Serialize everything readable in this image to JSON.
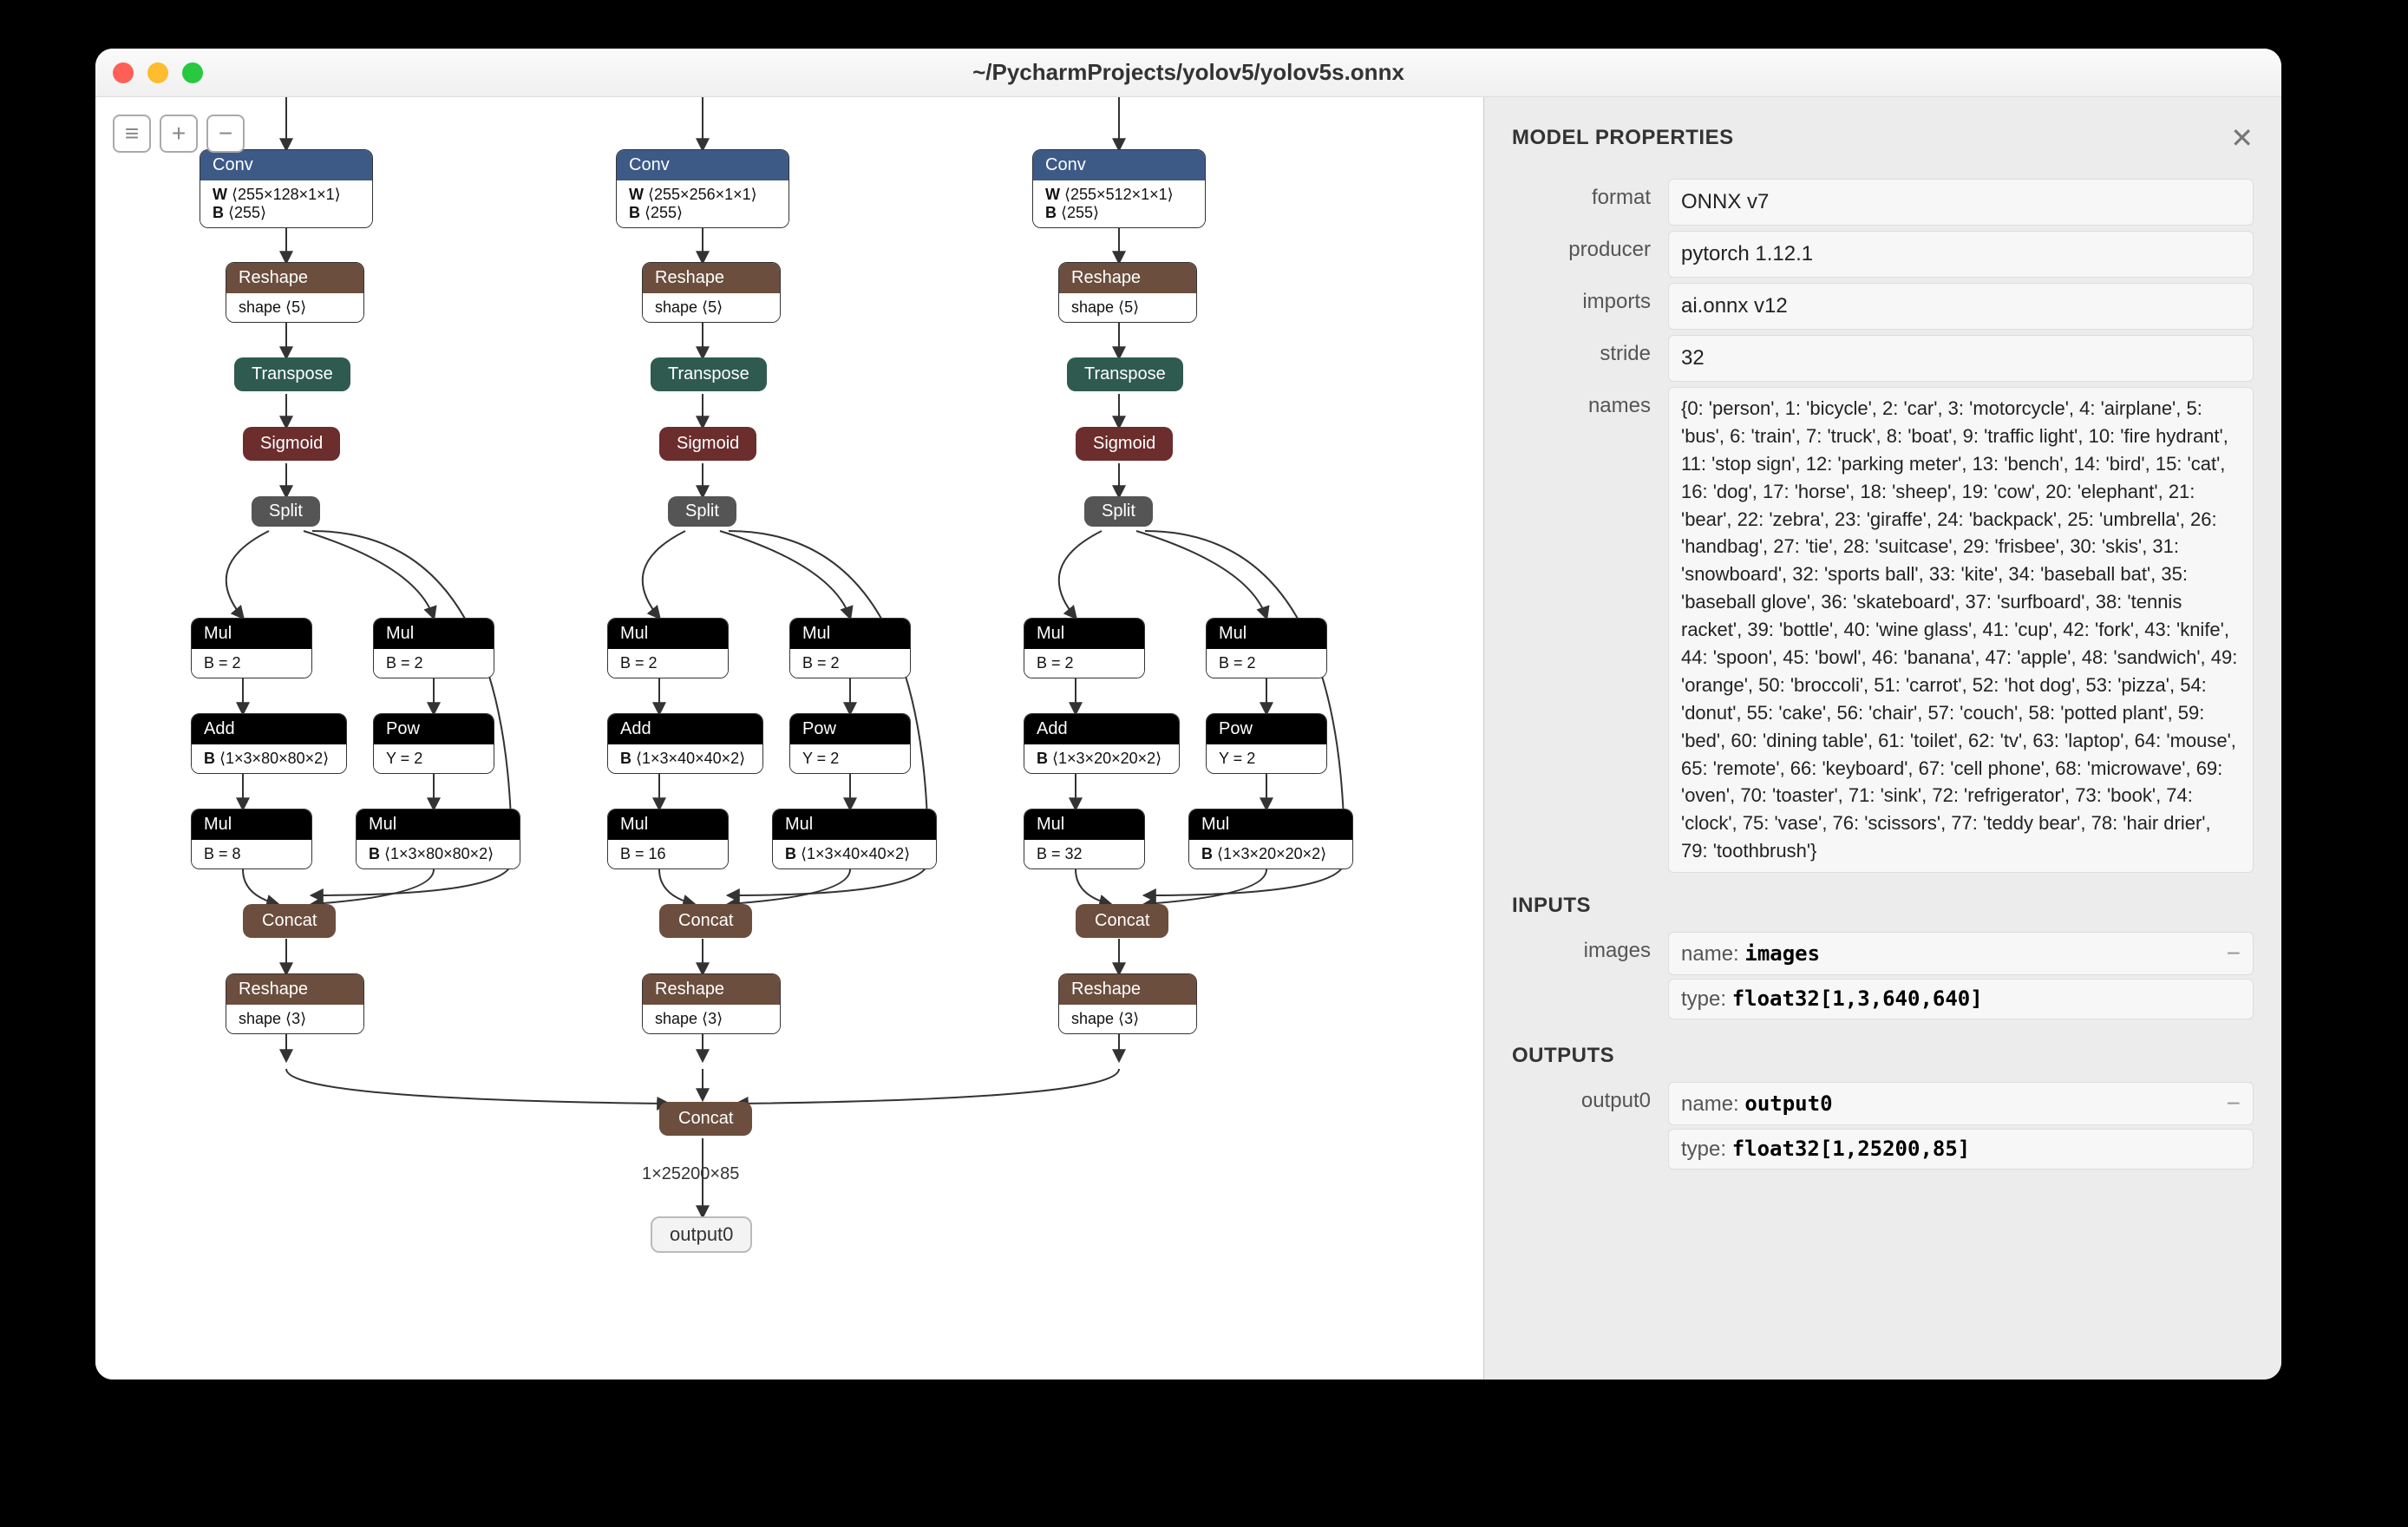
{
  "window_title": "~/PycharmProjects/yolov5/yolov5s.onnx",
  "sidebar": {
    "title": "MODEL PROPERTIES",
    "props": {
      "format": {
        "label": "format",
        "value": "ONNX v7"
      },
      "producer": {
        "label": "producer",
        "value": "pytorch 1.12.1"
      },
      "imports": {
        "label": "imports",
        "value": "ai.onnx v12"
      },
      "stride": {
        "label": "stride",
        "value": "32"
      },
      "names": {
        "label": "names",
        "value": "{0: 'person', 1: 'bicycle', 2: 'car', 3: 'motorcycle', 4: 'airplane', 5: 'bus', 6: 'train', 7: 'truck', 8: 'boat', 9: 'traffic light', 10: 'fire hydrant', 11: 'stop sign', 12: 'parking meter', 13: 'bench', 14: 'bird', 15: 'cat', 16: 'dog', 17: 'horse', 18: 'sheep', 19: 'cow', 20: 'elephant', 21: 'bear', 22: 'zebra', 23: 'giraffe', 24: 'backpack', 25: 'umbrella', 26: 'handbag', 27: 'tie', 28: 'suitcase', 29: 'frisbee', 30: 'skis', 31: 'snowboard', 32: 'sports ball', 33: 'kite', 34: 'baseball bat', 35: 'baseball glove', 36: 'skateboard', 37: 'surfboard', 38: 'tennis racket', 39: 'bottle', 40: 'wine glass', 41: 'cup', 42: 'fork', 43: 'knife', 44: 'spoon', 45: 'bowl', 46: 'banana', 47: 'apple', 48: 'sandwich', 49: 'orange', 50: 'broccoli', 51: 'carrot', 52: 'hot dog', 53: 'pizza', 54: 'donut', 55: 'cake', 56: 'chair', 57: 'couch', 58: 'potted plant', 59: 'bed', 60: 'dining table', 61: 'toilet', 62: 'tv', 63: 'laptop', 64: 'mouse', 65: 'remote', 66: 'keyboard', 67: 'cell phone', 68: 'microwave', 69: 'oven', 70: 'toaster', 71: 'sink', 72: 'refrigerator', 73: 'book', 74: 'clock', 75: 'vase', 76: 'scissors', 77: 'teddy bear', 78: 'hair drier', 79: 'toothbrush'}"
      }
    },
    "inputs_title": "INPUTS",
    "inputs": [
      {
        "slot": "images",
        "name_label": "name:",
        "name": "images",
        "type_label": "type:",
        "type": "float32[1,3,640,640]"
      }
    ],
    "outputs_title": "OUTPUTS",
    "outputs": [
      {
        "slot": "output0",
        "name_label": "name:",
        "name": "output0",
        "type_label": "type:",
        "type": "float32[1,25200,85]"
      }
    ]
  },
  "graph": {
    "columns": [
      {
        "conv": {
          "op": "Conv",
          "w": "W  ⟨255×128×1×1⟩",
          "b": "B  ⟨255⟩"
        },
        "reshape1": {
          "op": "Reshape",
          "body": "shape  ⟨5⟩"
        },
        "transpose": "Transpose",
        "sigmoid": "Sigmoid",
        "split": "Split",
        "mul1": {
          "op": "Mul",
          "body": "B = 2"
        },
        "mul2": {
          "op": "Mul",
          "body": "B = 2"
        },
        "add": {
          "op": "Add",
          "body": "B  ⟨1×3×80×80×2⟩"
        },
        "pow": {
          "op": "Pow",
          "body": "Y = 2"
        },
        "mul3": {
          "op": "Mul",
          "body": "B = 8"
        },
        "mul4": {
          "op": "Mul",
          "body": "B  ⟨1×3×80×80×2⟩"
        },
        "concat1": "Concat",
        "reshape2": {
          "op": "Reshape",
          "body": "shape  ⟨3⟩"
        }
      },
      {
        "conv": {
          "op": "Conv",
          "w": "W  ⟨255×256×1×1⟩",
          "b": "B  ⟨255⟩"
        },
        "reshape1": {
          "op": "Reshape",
          "body": "shape  ⟨5⟩"
        },
        "transpose": "Transpose",
        "sigmoid": "Sigmoid",
        "split": "Split",
        "mul1": {
          "op": "Mul",
          "body": "B = 2"
        },
        "mul2": {
          "op": "Mul",
          "body": "B = 2"
        },
        "add": {
          "op": "Add",
          "body": "B  ⟨1×3×40×40×2⟩"
        },
        "pow": {
          "op": "Pow",
          "body": "Y = 2"
        },
        "mul3": {
          "op": "Mul",
          "body": "B = 16"
        },
        "mul4": {
          "op": "Mul",
          "body": "B  ⟨1×3×40×40×2⟩"
        },
        "concat1": "Concat",
        "reshape2": {
          "op": "Reshape",
          "body": "shape  ⟨3⟩"
        }
      },
      {
        "conv": {
          "op": "Conv",
          "w": "W  ⟨255×512×1×1⟩",
          "b": "B  ⟨255⟩"
        },
        "reshape1": {
          "op": "Reshape",
          "body": "shape  ⟨5⟩"
        },
        "transpose": "Transpose",
        "sigmoid": "Sigmoid",
        "split": "Split",
        "mul1": {
          "op": "Mul",
          "body": "B = 2"
        },
        "mul2": {
          "op": "Mul",
          "body": "B = 2"
        },
        "add": {
          "op": "Add",
          "body": "B  ⟨1×3×20×20×2⟩"
        },
        "pow": {
          "op": "Pow",
          "body": "Y = 2"
        },
        "mul3": {
          "op": "Mul",
          "body": "B = 32"
        },
        "mul4": {
          "op": "Mul",
          "body": "B  ⟨1×3×20×20×2⟩"
        },
        "concat1": "Concat",
        "reshape2": {
          "op": "Reshape",
          "body": "shape  ⟨3⟩"
        }
      }
    ],
    "final_concat": "Concat",
    "final_dim": "1×25200×85",
    "final_out": "output0"
  }
}
